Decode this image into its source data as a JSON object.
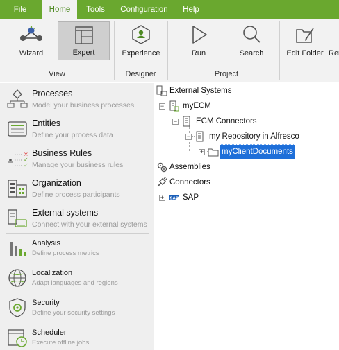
{
  "menu": {
    "file": "File",
    "home": "Home",
    "tools": "Tools",
    "configuration": "Configuration",
    "help": "Help"
  },
  "ribbon": {
    "wizard": "Wizard",
    "expert": "Expert",
    "experience": "Experience",
    "run": "Run",
    "search": "Search",
    "edit_folder": "Edit Folder",
    "remove_cut": "Rer",
    "group_view": "View",
    "group_designer": "Designer",
    "group_project": "Project"
  },
  "nav": {
    "processes": {
      "title": "Processes",
      "desc": "Model your business processes"
    },
    "entities": {
      "title": "Entities",
      "desc": "Define your process data"
    },
    "business_rules": {
      "title": "Business Rules",
      "desc": "Manage your business rules"
    },
    "organization": {
      "title": "Organization",
      "desc": "Define process participants"
    },
    "external_systems": {
      "title": "External systems",
      "desc": "Connect with your external systems"
    },
    "analysis": {
      "title": "Analysis",
      "desc": "Define process metrics"
    },
    "localization": {
      "title": "Localization",
      "desc": "Adapt languages and regions"
    },
    "security": {
      "title": "Security",
      "desc": "Define your security settings"
    },
    "scheduler": {
      "title": "Scheduler",
      "desc": "Execute offline jobs"
    }
  },
  "tree": {
    "external_systems": "External Systems",
    "my_ecm": "myECM",
    "ecm_connectors": "ECM Connectors",
    "my_repository": "my Repository in Alfresco",
    "my_client_documents": "myClientDocuments",
    "assemblies": "Assemblies",
    "connectors": "Connectors",
    "sap": "SAP",
    "sap_logo_text": "SAP"
  },
  "colors": {
    "menubar": "#6aa82f",
    "accent": "#4f8a24",
    "selection": "#1e6fd9"
  }
}
